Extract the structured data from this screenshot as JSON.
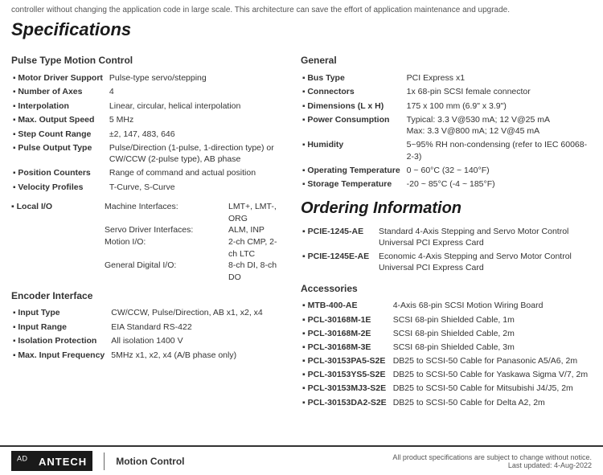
{
  "topText": "controller without changing the application code in large scale. This architecture can save the effort of application maintenance and upgrade.",
  "specifications": {
    "title": "Specifications",
    "pulse_section": {
      "heading": "Pulse Type Motion Control",
      "rows": [
        {
          "label": "Motor Driver Support",
          "value": "Pulse-type servo/stepping"
        },
        {
          "label": "Number of Axes",
          "value": "4"
        },
        {
          "label": "Interpolation",
          "value": "Linear, circular, helical interpolation"
        },
        {
          "label": "Max. Output Speed",
          "value": "5 MHz"
        },
        {
          "label": "Step Count Range",
          "value": "±2, 147, 483, 646"
        },
        {
          "label": "Pulse Output Type",
          "value": "Pulse/Direction (1-pulse, 1-direction type) or CW/CCW (2-pulse type), AB phase"
        },
        {
          "label": "Position Counters",
          "value": "Range of command and actual position"
        },
        {
          "label": "Velocity Profiles",
          "value": "T-Curve, S-Curve"
        }
      ],
      "localIO": {
        "label": "Local I/O",
        "rows": [
          {
            "key": "Machine Interfaces:",
            "val": "LMT+, LMT-, ORG"
          },
          {
            "key": "Servo Driver Interfaces:",
            "val": "ALM, INP"
          },
          {
            "key": "Motion I/O:",
            "val": "2-ch CMP, 2-ch LTC"
          },
          {
            "key": "General Digital I/O:",
            "val": "8-ch DI, 8-ch DO"
          }
        ]
      }
    },
    "encoder_section": {
      "heading": "Encoder Interface",
      "rows": [
        {
          "label": "Input Type",
          "value": "CW/CCW, Pulse/Direction, AB x1, x2, x4"
        },
        {
          "label": "Input Range",
          "value": "EIA Standard RS-422"
        },
        {
          "label": "Isolation Protection",
          "value": "All isolation 1400 V"
        },
        {
          "label": "Max. Input Frequency",
          "value": "5MHz x1, x2, x4 (A/B phase only)"
        }
      ]
    },
    "general_section": {
      "heading": "General",
      "rows": [
        {
          "label": "Bus Type",
          "value": "PCI Express x1"
        },
        {
          "label": "Connectors",
          "value": "1x 68-pin SCSI female connector"
        },
        {
          "label": "Dimensions (L x H)",
          "value": "175 x 100 mm (6.9\" x 3.9\")"
        },
        {
          "label": "Power Consumption",
          "value": "Typical: 3.3 V@530 mA; 12 V@25 mA\nMax: 3.3 V@800 mA; 12 V@45 mA"
        },
        {
          "label": "Humidity",
          "value": "5~95% RH non-condensing (refer to IEC 60068-2-3)"
        },
        {
          "label": "Operating Temperature",
          "value": "0 ~ 60°C (32 ~ 140°F)"
        },
        {
          "label": "Storage Temperature",
          "value": "-20 ~ 85°C (-4 ~ 185°F)"
        }
      ]
    }
  },
  "ordering": {
    "title": "Ordering Information",
    "items": [
      {
        "label": "PCIE-1245-AE",
        "value": "Standard 4-Axis Stepping and Servo Motor Control Universal PCI Express Card"
      },
      {
        "label": "PCIE-1245E-AE",
        "value": "Economic 4-Axis Stepping and Servo Motor Control Universal PCI Express Card"
      }
    ],
    "accessories_heading": "Accessories",
    "accessories": [
      {
        "label": "MTB-400-AE",
        "value": "4-Axis 68-pin SCSI Motion Wiring Board"
      },
      {
        "label": "PCL-30168M-1E",
        "value": "SCSI 68-pin Shielded Cable, 1m"
      },
      {
        "label": "PCL-30168M-2E",
        "value": "SCSI 68-pin Shielded Cable, 2m"
      },
      {
        "label": "PCL-30168M-3E",
        "value": "SCSI 68-pin Shielded Cable, 3m"
      },
      {
        "label": "PCL-30153PA5-S2E",
        "value": "DB25 to SCSI-50 Cable for Panasonic A5/A6, 2m"
      },
      {
        "label": "PCL-30153YS5-S2E",
        "value": "DB25 to SCSI-50 Cable for Yaskawa Sigma V/7, 2m"
      },
      {
        "label": "PCL-30153MJ3-S2E",
        "value": "DB25 to SCSI-50 Cable for Mitsubishi J4/J5, 2m"
      },
      {
        "label": "PCL-30153DA2-S2E",
        "value": "DB25 to SCSI-50 Cable for Delta A2, 2m"
      }
    ]
  },
  "footer": {
    "logo_text": "AD⧸ANTECH",
    "logo_brand": "ADVANTECH",
    "section_label": "Motion Control",
    "notice": "All product specifications are subject to change without notice.",
    "date": "Last updated: 4-Aug-2022"
  }
}
